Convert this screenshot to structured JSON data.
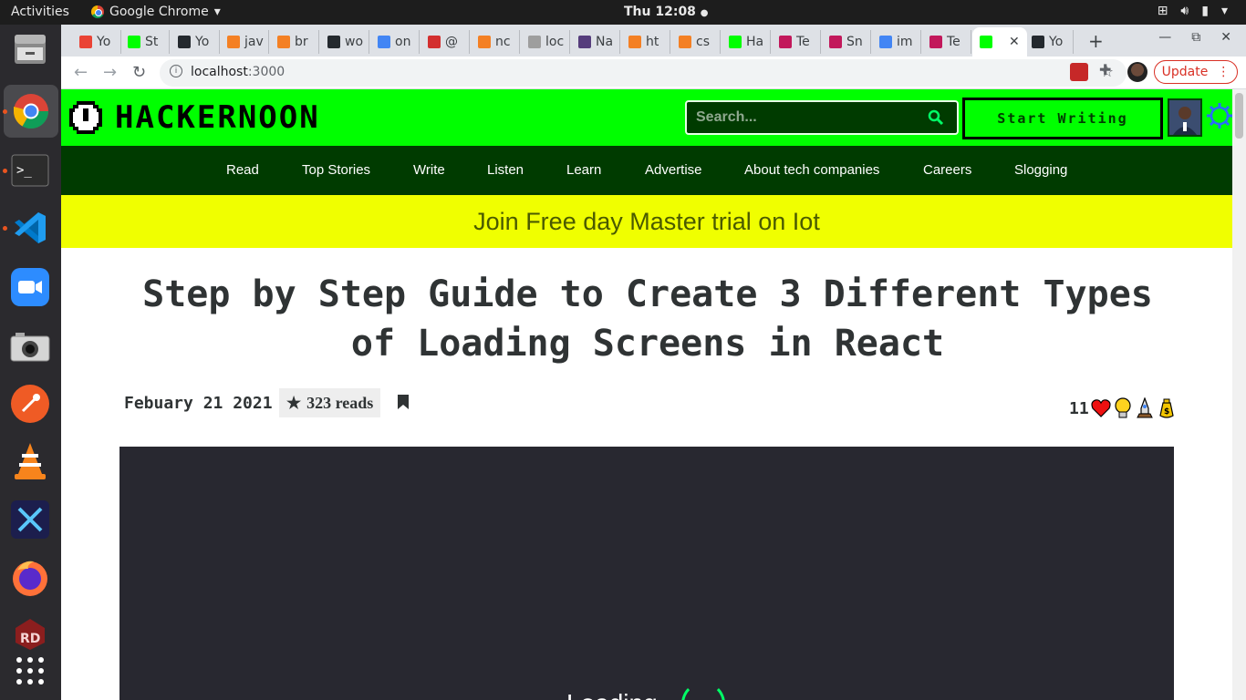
{
  "system": {
    "activities": "Activities",
    "app_name": "Google Chrome",
    "clock": "Thu 12:08"
  },
  "dock": {
    "apps": [
      "files-icon",
      "chrome-icon",
      "terminal-icon",
      "vscode-icon",
      "zoom-icon",
      "camera-icon",
      "postman-icon",
      "vlc-icon",
      "expressvpn-icon",
      "firefox-icon",
      "rd-icon",
      "app-grid-icon"
    ]
  },
  "browser": {
    "tabs": [
      {
        "label": "Yo",
        "icon": "gmail-icon",
        "color": "#ea4335"
      },
      {
        "label": "St",
        "icon": "hackernoon-icon",
        "color": "#00ff00"
      },
      {
        "label": "Yo",
        "icon": "github-icon",
        "color": "#24292e"
      },
      {
        "label": "jav",
        "icon": "stackoverflow-icon",
        "color": "#f48024"
      },
      {
        "label": "br",
        "icon": "stackoverflow-icon",
        "color": "#f48024"
      },
      {
        "label": "wo",
        "icon": "github-icon",
        "color": "#24292e"
      },
      {
        "label": "on",
        "icon": "google-icon",
        "color": "#4285f4"
      },
      {
        "label": "@",
        "icon": "red-icon",
        "color": "#d32f2f"
      },
      {
        "label": "nc",
        "icon": "stackoverflow-icon",
        "color": "#f48024"
      },
      {
        "label": "loc",
        "icon": "generic-icon",
        "color": "#9e9e9e"
      },
      {
        "label": "Na",
        "icon": "bootstrap-icon",
        "color": "#563d7c"
      },
      {
        "label": "ht",
        "icon": "stackoverflow-icon",
        "color": "#f48024"
      },
      {
        "label": "cs",
        "icon": "stackoverflow-icon",
        "color": "#f48024"
      },
      {
        "label": "Ha",
        "icon": "hackernoon-icon",
        "color": "#00ff00"
      },
      {
        "label": "Te",
        "icon": "music-icon",
        "color": "#c2185b"
      },
      {
        "label": "Sn",
        "icon": "music-icon",
        "color": "#c2185b"
      },
      {
        "label": "im",
        "icon": "google-icon",
        "color": "#4285f4"
      },
      {
        "label": "Te",
        "icon": "music-icon",
        "color": "#c2185b"
      },
      {
        "label": "",
        "icon": "hackernoon-icon",
        "color": "#00ff00",
        "active": true
      },
      {
        "label": "Yo",
        "icon": "github-icon",
        "color": "#24292e"
      }
    ],
    "url_host": "localhost",
    "url_port": ":3000",
    "update_label": "Update"
  },
  "site": {
    "logo_text": "HACKERNOON",
    "search_placeholder": "Search...",
    "start_writing": "Start Writing",
    "nav": [
      "Read",
      "Top Stories",
      "Write",
      "Listen",
      "Learn",
      "Advertise",
      "About tech companies",
      "Careers",
      "Slogging"
    ],
    "banner": "Join Free day Master trial on Iot",
    "colors": {
      "brand_green": "#00ff00",
      "nav_green": "#003b00",
      "banner_yellow": "#f0ff00"
    }
  },
  "article": {
    "title": "Step by Step Guide to Create 3 Different Types of Loading Screens in React",
    "date": "Febuary 21 2021",
    "reads": "323 reads",
    "reaction_count": "11",
    "hero_text": "Loading"
  }
}
